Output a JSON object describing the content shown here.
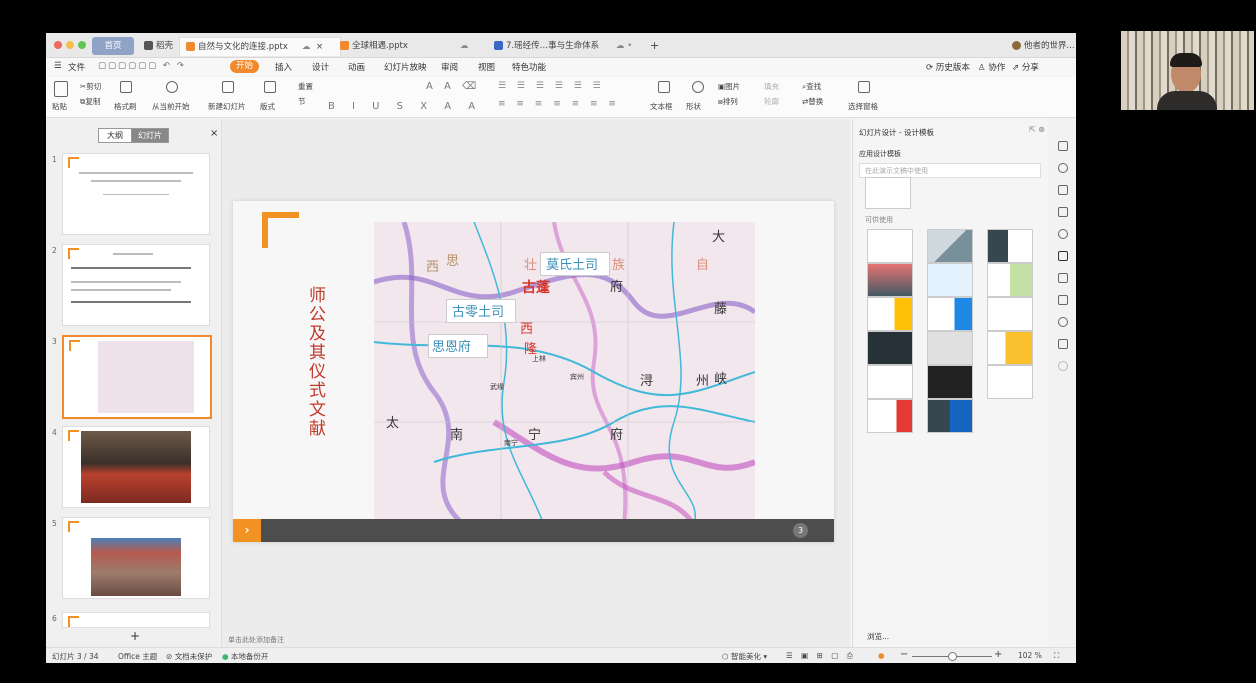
{
  "tabs": {
    "home": "首页",
    "shell": "稻壳",
    "doc1": "自然与文化的连接.pptx",
    "doc2": "全球相遇.pptx",
    "doc3": "7.瑶经传…事与生命体系",
    "user": "他者的世界..."
  },
  "menu": {
    "file": "文件",
    "start": "开始",
    "insert": "插入",
    "design": "设计",
    "animation": "动画",
    "slideshow": "幻灯片放映",
    "review": "审阅",
    "view": "视图",
    "special": "特色功能",
    "history": "历史版本",
    "collab": "协作",
    "share": "分享"
  },
  "ribbon": {
    "paste": "粘贴",
    "cut": "剪切",
    "copy": "复制",
    "format_painter": "格式刷",
    "from_start": "从当前开始",
    "new_slide": "新建幻灯片",
    "layout": "版式",
    "section": "节",
    "reset": "重置",
    "textbox": "文本框",
    "shape": "形状",
    "picture": "图片",
    "arrange": "排列",
    "fill": "填充",
    "outline": "轮廓",
    "find": "查找",
    "replace": "替换",
    "select_pane": "选择窗格"
  },
  "left_panel": {
    "outline_tab": "大纲",
    "slides_tab": "幻灯片",
    "close": "×",
    "slide_numbers": [
      "1",
      "2",
      "3",
      "4",
      "5",
      "6"
    ],
    "add": "+"
  },
  "slide": {
    "vertical_title": "师公及其仪式文献",
    "page_number": "3",
    "map_labels": {
      "mo_tusi": "莫氏土司",
      "gulin_tusi": "古零土司",
      "sien_fu": "思恩府",
      "gupeng": "古蓬",
      "xi": "西",
      "si": "思",
      "zhuang": "壮",
      "zu": "族",
      "zi": "自",
      "fu": "府",
      "long": "隆",
      "tai": "太",
      "nan": "南",
      "ning": "宁",
      "fu2": "府",
      "xun": "浔",
      "zhou": "州",
      "xia": "峡",
      "teng": "藤",
      "da": "大",
      "shanglin": "上林",
      "nanning": "南宁",
      "binzhou": "宾州",
      "wuyuan": "武缘"
    }
  },
  "notes_placeholder": "单击此处添加备注",
  "right_panel": {
    "title": "幻灯片设计 - 设计模板",
    "applied_label": "应用设计模板",
    "search_placeholder": "在此演示文稿中使用",
    "available_label": "可供使用",
    "browse": "浏览..."
  },
  "status": {
    "slide_count": "幻灯片 3 / 34",
    "theme": "Office 主题",
    "unprotected": "文档未保护",
    "backup": "本地备份开",
    "smart": "智能美化",
    "zoom": "102 %"
  },
  "colors": {
    "accent": "#f08a2c",
    "title_red": "#c0392b",
    "footer": "#4d4d4d"
  }
}
